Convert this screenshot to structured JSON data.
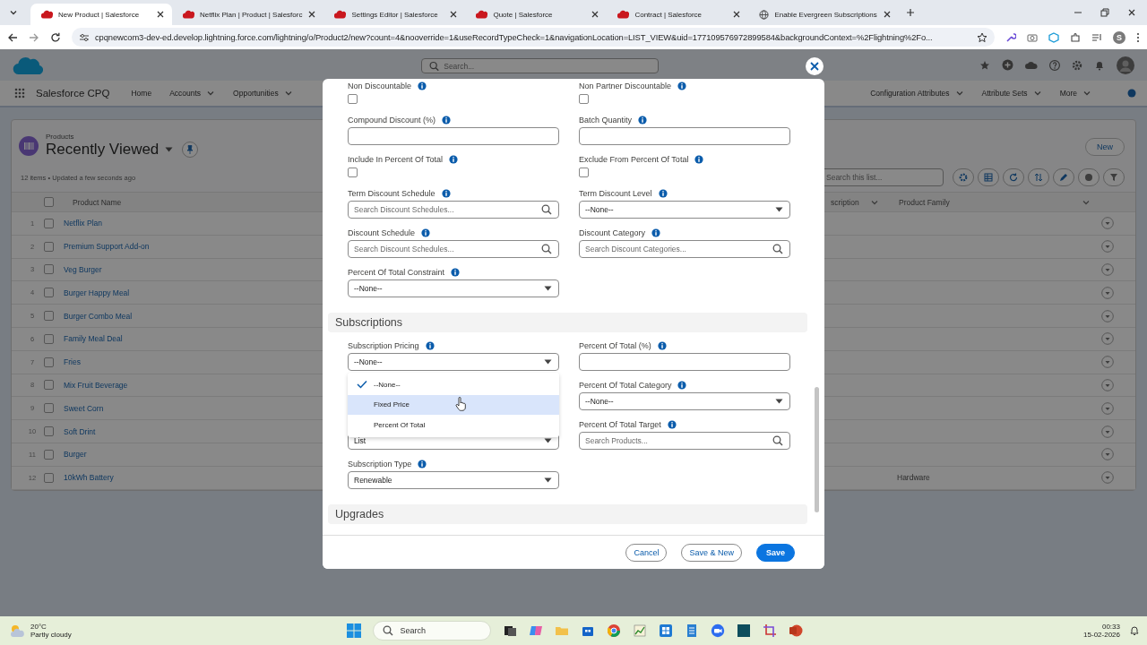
{
  "browser": {
    "tabs": [
      {
        "title": "New Product | Salesforce",
        "kind": "cloud",
        "selected": true
      },
      {
        "title": "Netflix Plan | Product | Salesforc",
        "kind": "cloud",
        "selected": false
      },
      {
        "title": "Settings Editor | Salesforce",
        "kind": "cloud",
        "selected": false
      },
      {
        "title": "Quote | Salesforce",
        "kind": "cloud",
        "selected": false
      },
      {
        "title": "Contract | Salesforce",
        "kind": "cloud",
        "selected": false
      },
      {
        "title": "Enable Evergreen Subscriptions",
        "kind": "globe",
        "selected": false
      }
    ],
    "url": "cpqnewcom3-dev-ed.develop.lightning.force.com/lightning/o/Product2/new?count=4&nooverride=1&useRecordTypeCheck=1&navigationLocation=LIST_VIEW&uid=177109576972899584&backgroundContext=%2Flightning%2Fo...",
    "profile_initial": "S"
  },
  "app": {
    "name": "Salesforce CPQ",
    "search_placeholder": "Search...",
    "nav_left": [
      {
        "label": "Home",
        "menu": false
      },
      {
        "label": "Accounts",
        "menu": true
      },
      {
        "label": "Opportunities",
        "menu": true
      }
    ],
    "nav_right": [
      {
        "label": "Configuration Attributes",
        "menu": true
      },
      {
        "label": "Attribute Sets",
        "menu": true
      },
      {
        "label": "More",
        "menu": true
      }
    ]
  },
  "list_view": {
    "object": "Products",
    "title": "Recently Viewed",
    "status": "12 items • Updated a few seconds ago",
    "new_button": "New",
    "search_placeholder": "Search this list...",
    "all_selected": false,
    "columns": [
      {
        "label": "Product Name"
      },
      {
        "label": "scription",
        "menu": true
      },
      {
        "label": "Product Family",
        "menu": true
      }
    ],
    "rows": [
      {
        "number": "1",
        "name": "Netflix Plan",
        "selected": false
      },
      {
        "number": "2",
        "name": "Premium Support Add-on",
        "selected": false
      },
      {
        "number": "3",
        "name": "Veg Burger",
        "selected": false
      },
      {
        "number": "4",
        "name": "Burger Happy Meal",
        "selected": false
      },
      {
        "number": "5",
        "name": "Burger Combo Meal",
        "selected": false
      },
      {
        "number": "6",
        "name": "Family Meal Deal",
        "selected": false
      },
      {
        "number": "7",
        "name": "Fries",
        "selected": false
      },
      {
        "number": "8",
        "name": "Mix Fruit Beverage",
        "selected": false
      },
      {
        "number": "9",
        "name": "Sweet Corn",
        "selected": false
      },
      {
        "number": "10",
        "name": "Soft Drint",
        "selected": false
      },
      {
        "number": "11",
        "name": "Burger",
        "selected": false
      },
      {
        "number": "12",
        "name": "10kWh Battery",
        "family": "Hardware",
        "selected": false
      }
    ]
  },
  "modal": {
    "sections": [
      {
        "rows": [
          {
            "left": {
              "kind": "checkbox",
              "label": "Non Discountable",
              "checked": false
            },
            "right": {
              "kind": "checkbox",
              "label": "Non Partner Discountable",
              "checked": false
            }
          },
          {
            "left": {
              "kind": "text",
              "label": "Compound Discount (%)"
            },
            "right": {
              "kind": "text",
              "label": "Batch Quantity"
            }
          },
          {
            "left": {
              "kind": "checkbox",
              "label": "Include In Percent Of Total",
              "checked": false
            },
            "right": {
              "kind": "checkbox",
              "label": "Exclude From Percent Of Total",
              "checked": false
            }
          },
          {
            "left": {
              "kind": "lookup",
              "label": "Term Discount Schedule",
              "placeholder": "Search Discount Schedules..."
            },
            "right": {
              "kind": "picklist",
              "label": "Term Discount Level",
              "value": "--None--"
            }
          },
          {
            "left": {
              "kind": "lookup",
              "label": "Discount Schedule",
              "placeholder": "Search Discount Schedules..."
            },
            "right": {
              "kind": "lookup",
              "label": "Discount Category",
              "placeholder": "Search Discount Categories..."
            }
          },
          {
            "left": {
              "kind": "picklist",
              "label": "Percent Of Total Constraint",
              "value": "--None--"
            }
          }
        ]
      },
      {
        "title": "Subscriptions",
        "rows": [
          {
            "left": {
              "kind": "picklist",
              "label": "Subscription Pricing",
              "value": "--None--",
              "open": true,
              "options": [
                {
                  "label": "--None--",
                  "selected": true,
                  "hovered": false
                },
                {
                  "label": "Fixed Price",
                  "selected": false,
                  "hovered": true
                },
                {
                  "label": "Percent Of Total",
                  "selected": false,
                  "hovered": false
                }
              ]
            },
            "right": {
              "kind": "text",
              "label": "Percent Of Total (%)"
            }
          },
          {
            "right": {
              "kind": "picklist",
              "label": "Percent Of Total Category",
              "value": "--None--"
            }
          },
          {
            "left": {
              "kind": "picklist",
              "value": "List"
            },
            "right": {
              "kind": "lookup",
              "label": "Percent Of Total Target",
              "placeholder": "Search Products..."
            }
          },
          {
            "left": {
              "kind": "picklist",
              "label": "Subscription Type",
              "value": "Renewable"
            }
          }
        ]
      },
      {
        "title": "Upgrades"
      }
    ],
    "buttons": [
      {
        "label": "Cancel",
        "kind": "neutral"
      },
      {
        "label": "Save & New",
        "kind": "neutral"
      },
      {
        "label": "Save",
        "kind": "brand"
      }
    ]
  },
  "taskbar": {
    "temperature": "20°C",
    "weather": "Partly cloudy",
    "search": "Search",
    "time": "00:33",
    "date": "15-02-2026"
  }
}
